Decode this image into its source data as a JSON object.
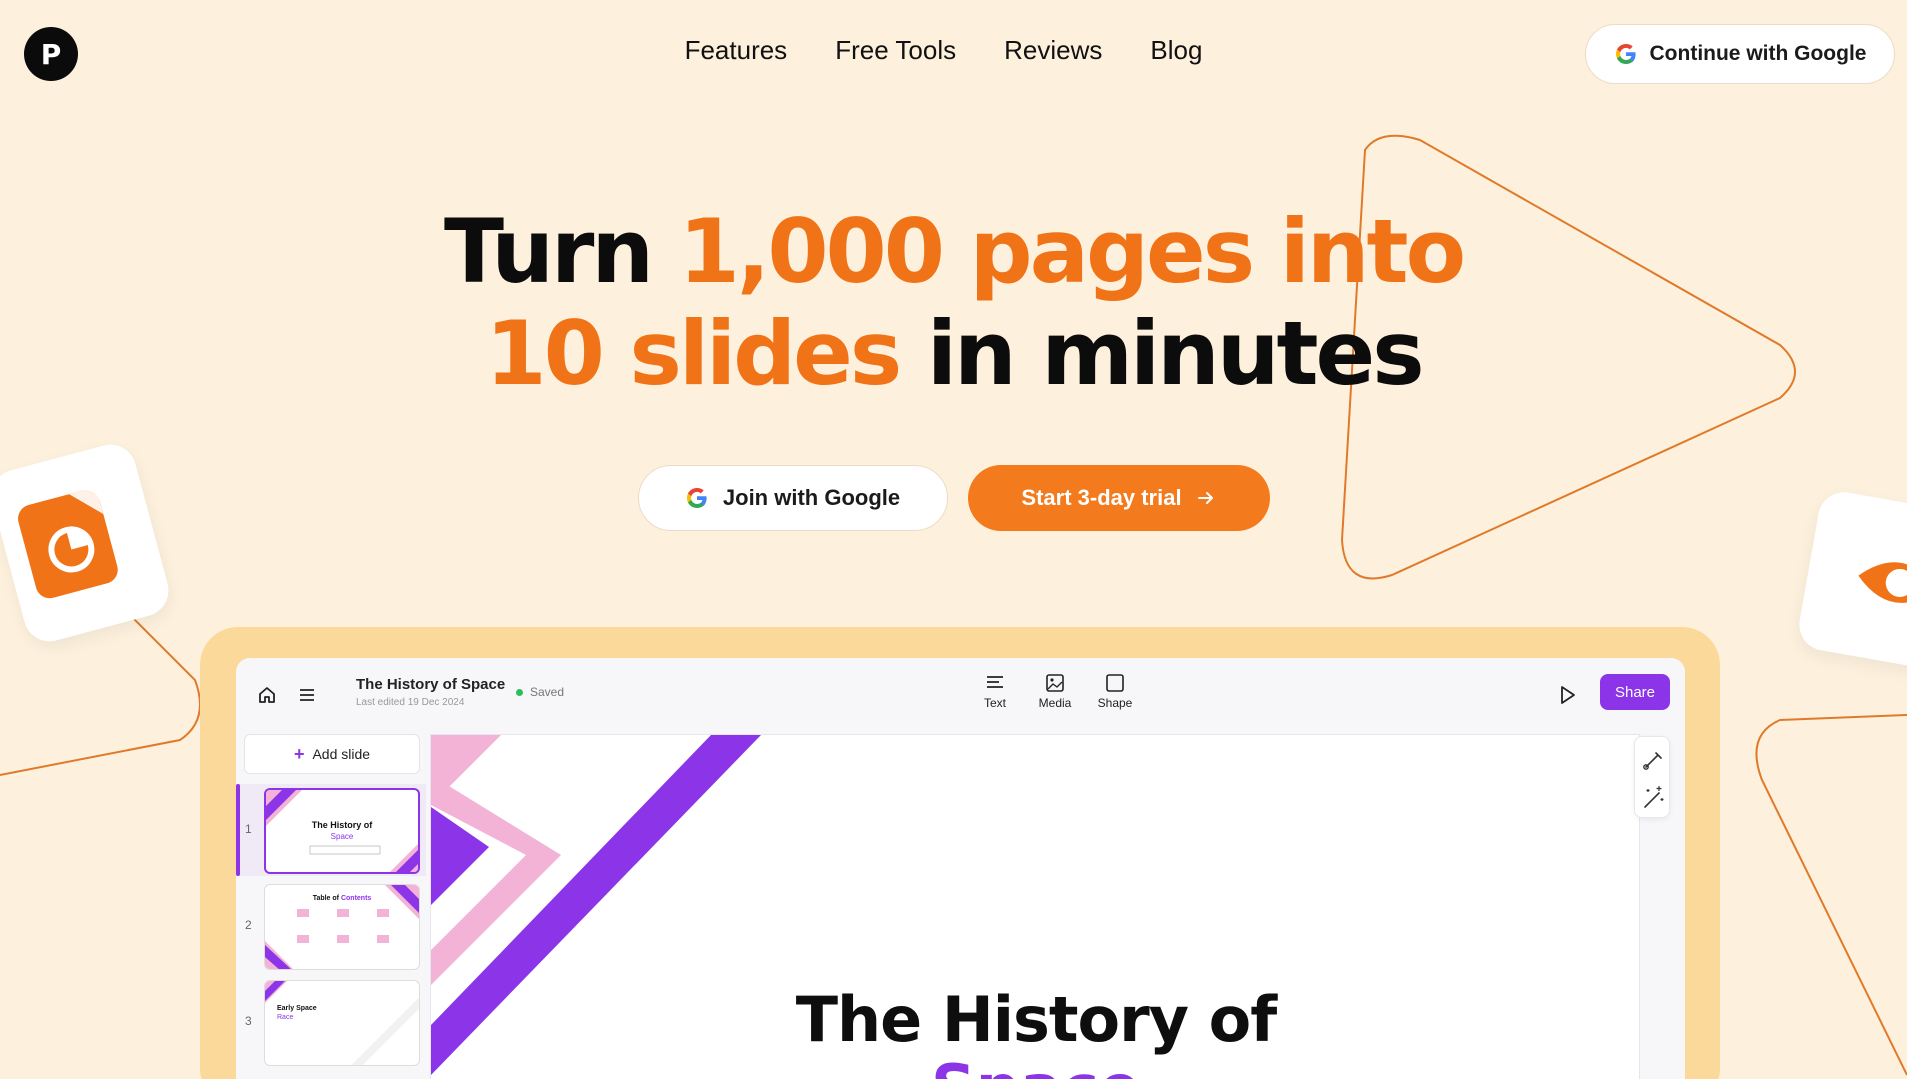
{
  "header": {
    "logo_letter": "P",
    "nav": [
      "Features",
      "Free Tools",
      "Reviews",
      "Blog"
    ],
    "continue_google": "Continue with Google"
  },
  "hero": {
    "line1_plain": "Turn",
    "line1_accent": "1,000 pages into",
    "line2_accent": "10 slides",
    "line2_plain": "in minutes",
    "join_google": "Join with Google",
    "start_trial": "Start 3-day trial",
    "accent_color": "#f07318"
  },
  "app": {
    "doc_title": "The History of Space",
    "last_edited": "Last edited 19 Dec 2024",
    "saved": "Saved",
    "tools": [
      "Text",
      "Media",
      "Shape"
    ],
    "share": "Share",
    "add_slide": "Add slide",
    "slides": [
      {
        "num": "1",
        "title": "The History of",
        "sub": "Space"
      },
      {
        "num": "2",
        "title": "Table of",
        "sub": "Contents"
      },
      {
        "num": "3",
        "title": "Early Space",
        "sub": "Race"
      }
    ],
    "canvas_title": "The History of",
    "canvas_sub": "Space",
    "brand_purple": "#8b34e8"
  }
}
